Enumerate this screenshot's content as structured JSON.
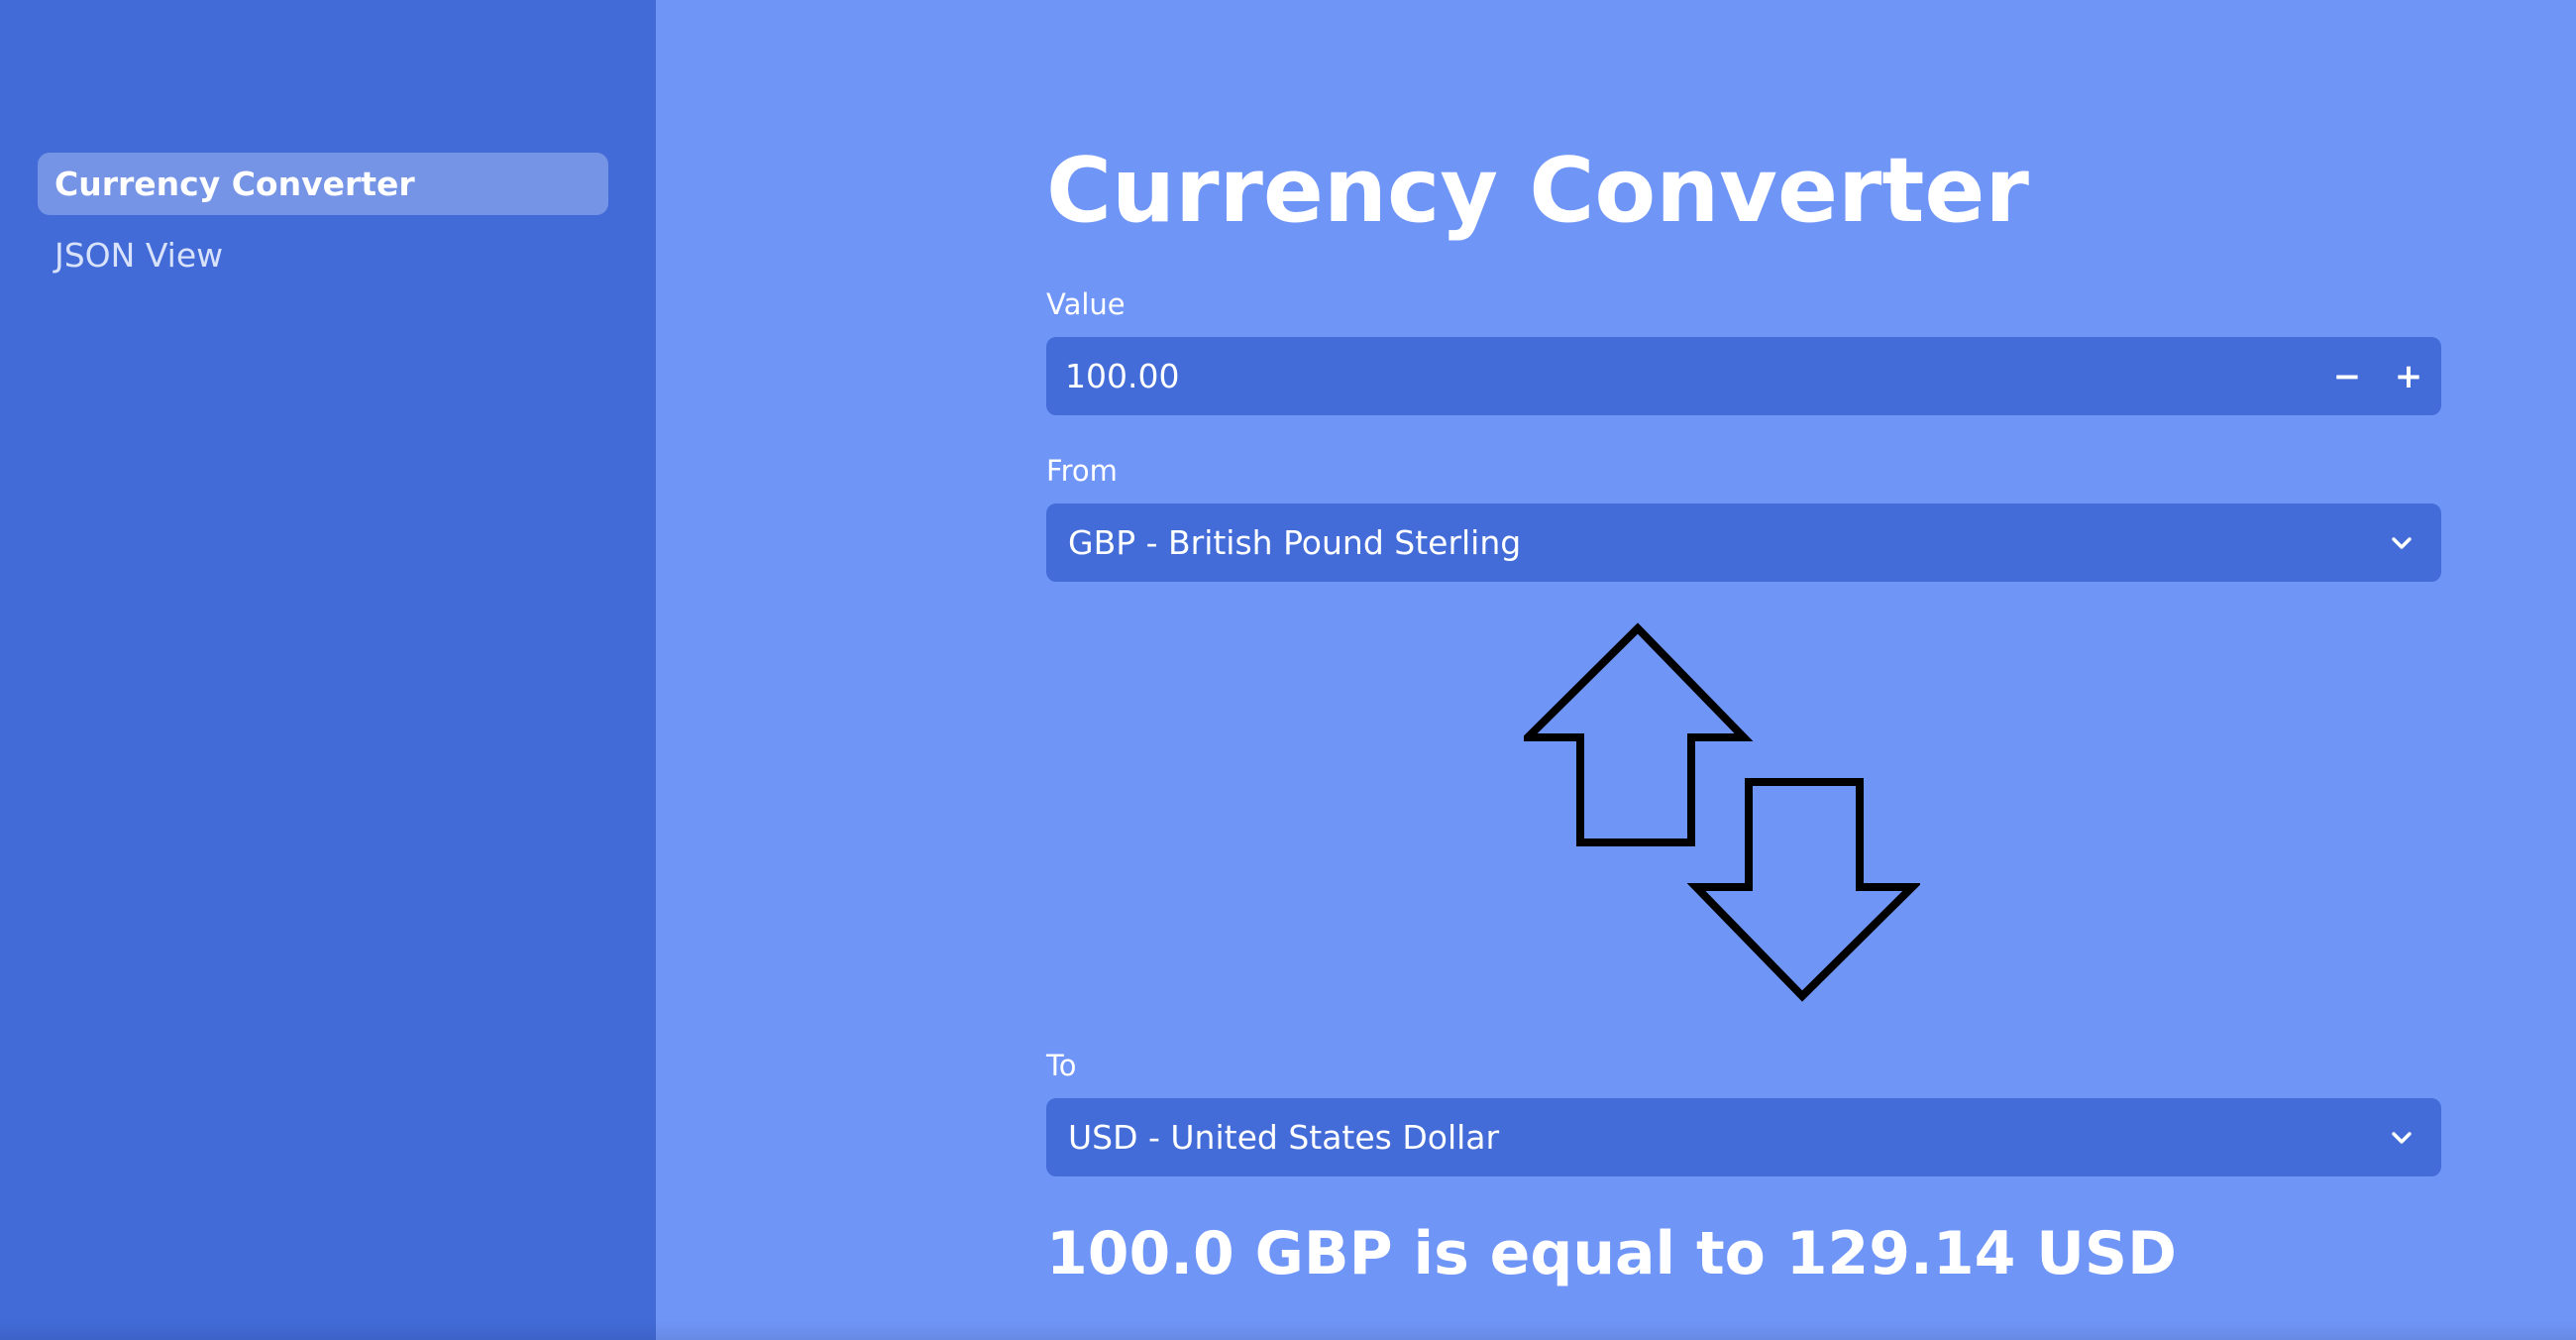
{
  "sidebar": {
    "items": [
      {
        "label": "Currency Converter",
        "active": true
      },
      {
        "label": "JSON View",
        "active": false
      }
    ]
  },
  "main": {
    "title": "Currency Converter",
    "value_field": {
      "label": "Value",
      "value": "100.00",
      "decrement_label": "−",
      "increment_label": "+"
    },
    "from_field": {
      "label": "From",
      "selected": "GBP - British Pound Sterling"
    },
    "swap": {
      "icon": "swap-arrows-icon"
    },
    "to_field": {
      "label": "To",
      "selected": "USD - United States Dollar"
    },
    "result": "100.0 GBP is equal to 129.14 USD"
  },
  "colors": {
    "sidebar_bg": "#426bd8",
    "main_bg": "#6f95f7",
    "active_item_bg": "#7594e6",
    "field_bg": "#436cd9",
    "text": "#ffffff"
  }
}
